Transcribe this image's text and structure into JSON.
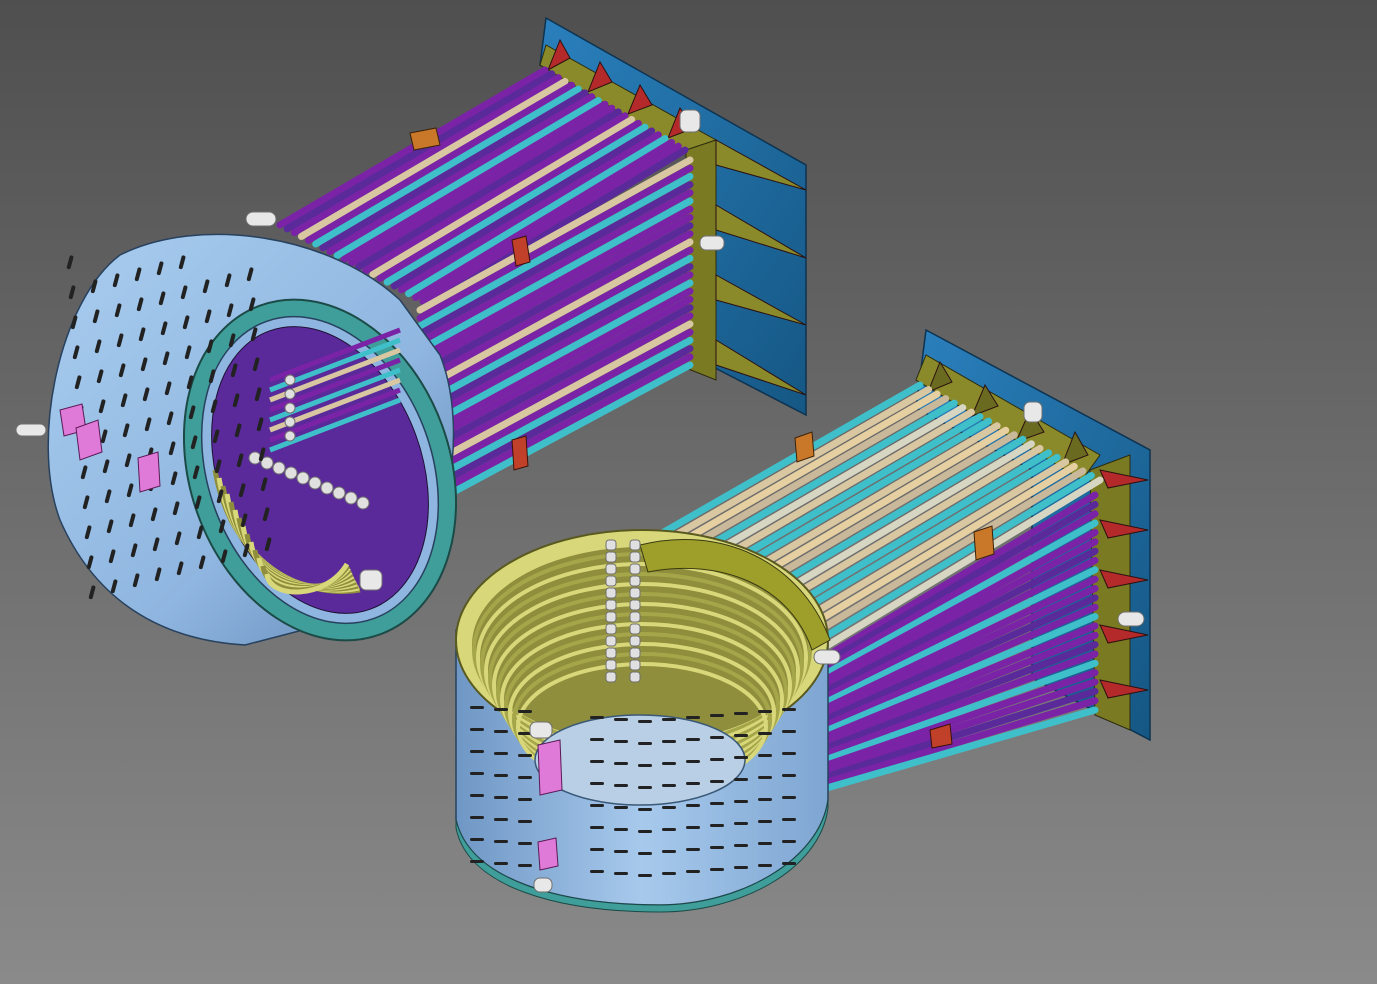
{
  "viewport": {
    "background_top": "#4f4f4f",
    "background_bottom": "#8a8a8a"
  },
  "colors": {
    "shell_blue": "#8fb6e0",
    "shell_shadow": "#5f86b4",
    "rim_teal": "#3f9e9a",
    "rim_teal_light": "#6cc2bd",
    "coil_yellow": "#d8d87a",
    "coil_olive": "#8e8e3c",
    "tube_purple": "#7a23a6",
    "tube_violet": "#5a2a9a",
    "tube_cyan": "#3fbfc9",
    "tube_beige": "#d9c7a2",
    "flange_blue": "#1e6fa6",
    "gusset_olive": "#8a8a2a",
    "gusset_red": "#b42a2a",
    "clip_pink": "#e07ad8",
    "lug_orange": "#c9782a"
  },
  "objects": [
    {
      "name": "heater-assembly-1",
      "description_icon": "cylinder-with-tube-bank"
    },
    {
      "name": "heater-assembly-2",
      "description_icon": "open-cylinder-with-tube-bank"
    }
  ]
}
